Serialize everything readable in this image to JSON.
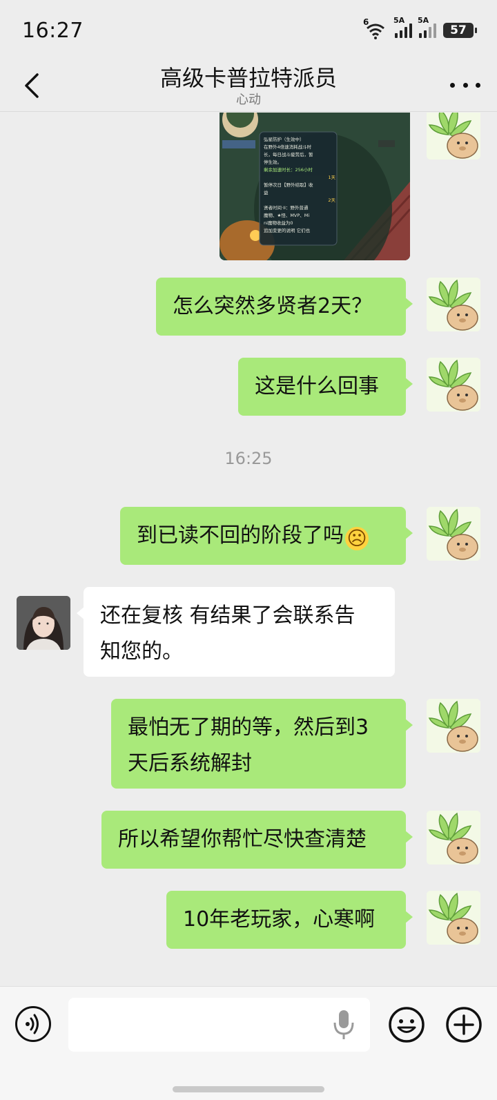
{
  "status_bar": {
    "time": "16:27",
    "network_1": "5A",
    "network_2": "5A",
    "battery": "57",
    "wifi_label": "6"
  },
  "header": {
    "title": "高级卡普拉特派员",
    "subtitle": "心动"
  },
  "messages": [
    {
      "from": "me",
      "type": "image",
      "text_lines": [
        "弘星防护（生效中）",
        "在野外4倍速消耗战斗时",
        "长，每日战斗疲劳后，暂",
        "停生效。",
        "剩余加速时长：256小时",
        "1天",
        "暂停次日【野外结取】收",
        "益",
        "2天",
        "贤者时间·II：野外普通",
        "魔物、★怪、MVP、Mi",
        "ni魔物收益为0",
        "追加变更的说明  它们也"
      ]
    },
    {
      "from": "me",
      "text": "怎么突然多贤者2天？"
    },
    {
      "from": "me",
      "text": "这是什么回事"
    },
    {
      "type": "time",
      "text": "16:25"
    },
    {
      "from": "me",
      "text": "到已读不回的阶段了吗",
      "emoji": "☹"
    },
    {
      "from": "other",
      "text_lines": [
        "还在复核 有结果了会联系告",
        "知您的。"
      ]
    },
    {
      "from": "me",
      "text_lines": [
        "最怕无了期的等，然后到3",
        "天后系统解封"
      ]
    },
    {
      "from": "me",
      "text": "所以希望你帮忙尽快查清楚"
    },
    {
      "from": "me",
      "text": "10年老玩家，心寒啊"
    }
  ],
  "input": {
    "value": "",
    "voice_icon": "voice-icon",
    "mic_icon": "microphone-icon",
    "emoji_icon": "emoji-icon",
    "plus_icon": "plus-icon"
  },
  "colors": {
    "my_bubble": "#a9e97a",
    "other_bubble": "#ffffff",
    "background": "#ededed"
  }
}
